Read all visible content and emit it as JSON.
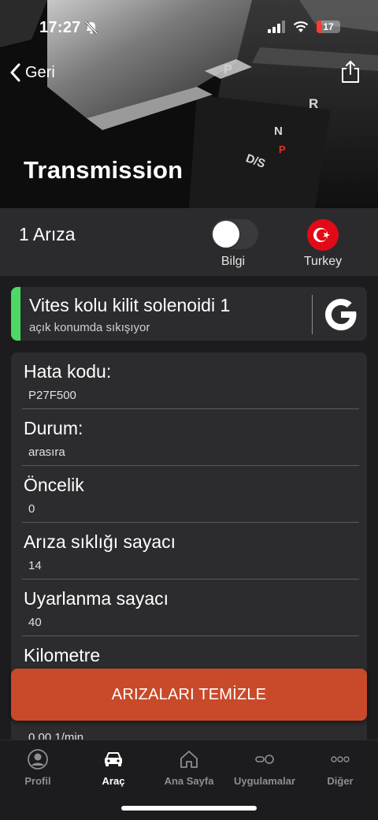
{
  "status_bar": {
    "time": "17:27",
    "battery": "17"
  },
  "nav": {
    "back_label": "Geri"
  },
  "header": {
    "title": "Transmission",
    "shifter_labels": [
      "P",
      "R",
      "N",
      "P",
      "D/S"
    ]
  },
  "summary": {
    "fault_count": "1 Arıza",
    "toggle_label": "Bilgi",
    "toggle_on": false,
    "region_label": "Turkey"
  },
  "fault": {
    "title": "Vites kolu kilit solenoidi 1",
    "subtitle": "açık konumda sıkışıyor",
    "accent_color": "#4cd964"
  },
  "details": [
    {
      "label": "Hata kodu:",
      "value": "P27F500"
    },
    {
      "label": "Durum:",
      "value": "arasıra"
    },
    {
      "label": "Öncelik",
      "value": "0"
    },
    {
      "label": "Arıza sıklığı sayacı",
      "value": "14"
    },
    {
      "label": "Uyarlanma sayacı",
      "value": "40"
    },
    {
      "label": "Kilometre",
      "value": ""
    }
  ],
  "partial_value": "0.00 1/min",
  "clear_button": {
    "label": "ARIZALARI TEMİZLE",
    "color": "#c84a2a"
  },
  "tabs": [
    {
      "label": "Profil",
      "icon": "person-icon",
      "active": false
    },
    {
      "label": "Araç",
      "icon": "car-icon",
      "active": true
    },
    {
      "label": "Ana Sayfa",
      "icon": "home-icon",
      "active": false
    },
    {
      "label": "Uygulamalar",
      "icon": "apps-icon",
      "active": false
    },
    {
      "label": "Diğer",
      "icon": "more-icon",
      "active": false
    }
  ]
}
